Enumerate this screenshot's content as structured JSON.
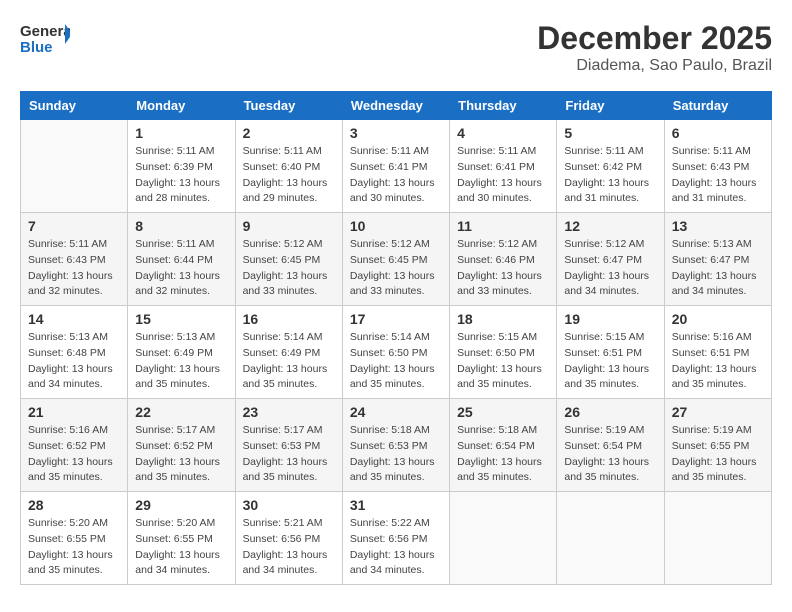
{
  "logo": {
    "general": "General",
    "blue": "Blue"
  },
  "title": {
    "month": "December 2025",
    "location": "Diadema, Sao Paulo, Brazil"
  },
  "days_of_week": [
    "Sunday",
    "Monday",
    "Tuesday",
    "Wednesday",
    "Thursday",
    "Friday",
    "Saturday"
  ],
  "weeks": [
    [
      {
        "day": "",
        "sunrise": "",
        "sunset": "",
        "daylight": "",
        "empty": true
      },
      {
        "day": "1",
        "sunrise": "Sunrise: 5:11 AM",
        "sunset": "Sunset: 6:39 PM",
        "daylight": "Daylight: 13 hours and 28 minutes."
      },
      {
        "day": "2",
        "sunrise": "Sunrise: 5:11 AM",
        "sunset": "Sunset: 6:40 PM",
        "daylight": "Daylight: 13 hours and 29 minutes."
      },
      {
        "day": "3",
        "sunrise": "Sunrise: 5:11 AM",
        "sunset": "Sunset: 6:41 PM",
        "daylight": "Daylight: 13 hours and 30 minutes."
      },
      {
        "day": "4",
        "sunrise": "Sunrise: 5:11 AM",
        "sunset": "Sunset: 6:41 PM",
        "daylight": "Daylight: 13 hours and 30 minutes."
      },
      {
        "day": "5",
        "sunrise": "Sunrise: 5:11 AM",
        "sunset": "Sunset: 6:42 PM",
        "daylight": "Daylight: 13 hours and 31 minutes."
      },
      {
        "day": "6",
        "sunrise": "Sunrise: 5:11 AM",
        "sunset": "Sunset: 6:43 PM",
        "daylight": "Daylight: 13 hours and 31 minutes."
      }
    ],
    [
      {
        "day": "7",
        "sunrise": "Sunrise: 5:11 AM",
        "sunset": "Sunset: 6:43 PM",
        "daylight": "Daylight: 13 hours and 32 minutes."
      },
      {
        "day": "8",
        "sunrise": "Sunrise: 5:11 AM",
        "sunset": "Sunset: 6:44 PM",
        "daylight": "Daylight: 13 hours and 32 minutes."
      },
      {
        "day": "9",
        "sunrise": "Sunrise: 5:12 AM",
        "sunset": "Sunset: 6:45 PM",
        "daylight": "Daylight: 13 hours and 33 minutes."
      },
      {
        "day": "10",
        "sunrise": "Sunrise: 5:12 AM",
        "sunset": "Sunset: 6:45 PM",
        "daylight": "Daylight: 13 hours and 33 minutes."
      },
      {
        "day": "11",
        "sunrise": "Sunrise: 5:12 AM",
        "sunset": "Sunset: 6:46 PM",
        "daylight": "Daylight: 13 hours and 33 minutes."
      },
      {
        "day": "12",
        "sunrise": "Sunrise: 5:12 AM",
        "sunset": "Sunset: 6:47 PM",
        "daylight": "Daylight: 13 hours and 34 minutes."
      },
      {
        "day": "13",
        "sunrise": "Sunrise: 5:13 AM",
        "sunset": "Sunset: 6:47 PM",
        "daylight": "Daylight: 13 hours and 34 minutes."
      }
    ],
    [
      {
        "day": "14",
        "sunrise": "Sunrise: 5:13 AM",
        "sunset": "Sunset: 6:48 PM",
        "daylight": "Daylight: 13 hours and 34 minutes."
      },
      {
        "day": "15",
        "sunrise": "Sunrise: 5:13 AM",
        "sunset": "Sunset: 6:49 PM",
        "daylight": "Daylight: 13 hours and 35 minutes."
      },
      {
        "day": "16",
        "sunrise": "Sunrise: 5:14 AM",
        "sunset": "Sunset: 6:49 PM",
        "daylight": "Daylight: 13 hours and 35 minutes."
      },
      {
        "day": "17",
        "sunrise": "Sunrise: 5:14 AM",
        "sunset": "Sunset: 6:50 PM",
        "daylight": "Daylight: 13 hours and 35 minutes."
      },
      {
        "day": "18",
        "sunrise": "Sunrise: 5:15 AM",
        "sunset": "Sunset: 6:50 PM",
        "daylight": "Daylight: 13 hours and 35 minutes."
      },
      {
        "day": "19",
        "sunrise": "Sunrise: 5:15 AM",
        "sunset": "Sunset: 6:51 PM",
        "daylight": "Daylight: 13 hours and 35 minutes."
      },
      {
        "day": "20",
        "sunrise": "Sunrise: 5:16 AM",
        "sunset": "Sunset: 6:51 PM",
        "daylight": "Daylight: 13 hours and 35 minutes."
      }
    ],
    [
      {
        "day": "21",
        "sunrise": "Sunrise: 5:16 AM",
        "sunset": "Sunset: 6:52 PM",
        "daylight": "Daylight: 13 hours and 35 minutes."
      },
      {
        "day": "22",
        "sunrise": "Sunrise: 5:17 AM",
        "sunset": "Sunset: 6:52 PM",
        "daylight": "Daylight: 13 hours and 35 minutes."
      },
      {
        "day": "23",
        "sunrise": "Sunrise: 5:17 AM",
        "sunset": "Sunset: 6:53 PM",
        "daylight": "Daylight: 13 hours and 35 minutes."
      },
      {
        "day": "24",
        "sunrise": "Sunrise: 5:18 AM",
        "sunset": "Sunset: 6:53 PM",
        "daylight": "Daylight: 13 hours and 35 minutes."
      },
      {
        "day": "25",
        "sunrise": "Sunrise: 5:18 AM",
        "sunset": "Sunset: 6:54 PM",
        "daylight": "Daylight: 13 hours and 35 minutes."
      },
      {
        "day": "26",
        "sunrise": "Sunrise: 5:19 AM",
        "sunset": "Sunset: 6:54 PM",
        "daylight": "Daylight: 13 hours and 35 minutes."
      },
      {
        "day": "27",
        "sunrise": "Sunrise: 5:19 AM",
        "sunset": "Sunset: 6:55 PM",
        "daylight": "Daylight: 13 hours and 35 minutes."
      }
    ],
    [
      {
        "day": "28",
        "sunrise": "Sunrise: 5:20 AM",
        "sunset": "Sunset: 6:55 PM",
        "daylight": "Daylight: 13 hours and 35 minutes."
      },
      {
        "day": "29",
        "sunrise": "Sunrise: 5:20 AM",
        "sunset": "Sunset: 6:55 PM",
        "daylight": "Daylight: 13 hours and 34 minutes."
      },
      {
        "day": "30",
        "sunrise": "Sunrise: 5:21 AM",
        "sunset": "Sunset: 6:56 PM",
        "daylight": "Daylight: 13 hours and 34 minutes."
      },
      {
        "day": "31",
        "sunrise": "Sunrise: 5:22 AM",
        "sunset": "Sunset: 6:56 PM",
        "daylight": "Daylight: 13 hours and 34 minutes."
      },
      {
        "day": "",
        "sunrise": "",
        "sunset": "",
        "daylight": "",
        "empty": true
      },
      {
        "day": "",
        "sunrise": "",
        "sunset": "",
        "daylight": "",
        "empty": true
      },
      {
        "day": "",
        "sunrise": "",
        "sunset": "",
        "daylight": "",
        "empty": true
      }
    ]
  ]
}
